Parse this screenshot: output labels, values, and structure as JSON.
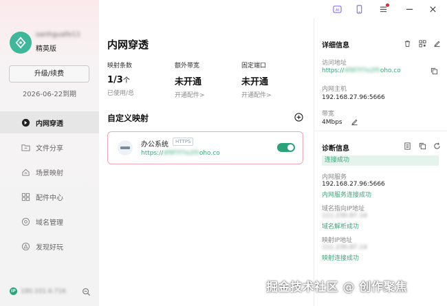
{
  "sidebar": {
    "username": "sanhguafe11",
    "edition": "精英版",
    "upgrade_label": "升级/续费",
    "expiry": "2026-06-22到期",
    "items": [
      {
        "label": "内网穿透",
        "icon": "tunnel-icon",
        "active": true
      },
      {
        "label": "文件分享",
        "icon": "folder-icon",
        "active": false
      },
      {
        "label": "场景映射",
        "icon": "home-icon",
        "active": false
      },
      {
        "label": "配件中心",
        "icon": "grid-icon",
        "active": false
      },
      {
        "label": "域名管理",
        "icon": "domain-icon",
        "active": false
      },
      {
        "label": "发现好玩",
        "icon": "discover-icon",
        "active": false
      }
    ],
    "ip_badge": "IP",
    "ip_value": "180.101.6.716"
  },
  "main": {
    "title": "内网穿透",
    "stats": [
      {
        "label": "映射条数",
        "value": "1/3",
        "unit": "个",
        "sub": "已使用/总"
      },
      {
        "label": "额外带宽",
        "value": "未开通",
        "unit": "",
        "sub": "开通配件>"
      },
      {
        "label": "固定端口",
        "value": "未开通",
        "unit": "",
        "sub": "开通配件>"
      }
    ],
    "section_title": "自定义映射",
    "mapping": {
      "name": "办公系统",
      "badge": "HTTPS",
      "url_prefix": "https://",
      "url_blurred": "4f9f7f7e2f5",
      "url_suffix": "oho.co",
      "enabled": true
    }
  },
  "detail": {
    "title": "详细信息",
    "visit_label": "访问地址",
    "visit_prefix": "https://",
    "visit_blurred": "4f9f7f7e2f5",
    "visit_suffix": "oho.co",
    "host_label": "内网主机",
    "host_value": "192.168.27.96:5666",
    "bandwidth_label": "带宽",
    "bandwidth_value": "4Mbps"
  },
  "diagnosis": {
    "title": "诊断信息",
    "status": "连接成功",
    "service_label": "内网服务",
    "service_value": "192.168.27.96:5666",
    "service_status": "内网服务连接成功",
    "domain_label": "域名指向IP地址",
    "domain_value": "111.230.87.14",
    "domain_status": "域名解析成功",
    "mapip_label": "映射IP地址",
    "mapip_value": "111.230.87.14",
    "mapip_status": "映射连接成功"
  },
  "watermark": "掘金技术社区 @ 创作聚焦",
  "colors": {
    "accent": "#2ba37a",
    "link": "#3aa67a",
    "card_border": "#f0a7b3",
    "notify_dot": "#e02b2b"
  }
}
